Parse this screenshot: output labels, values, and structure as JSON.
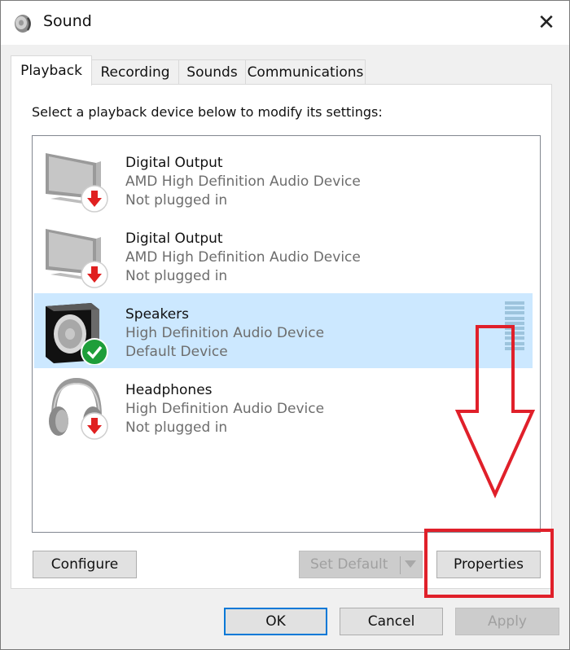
{
  "window": {
    "title": "Sound",
    "icon": "speaker-icon",
    "close_icon": "close-icon",
    "close_glyph": "✕"
  },
  "tabs": [
    {
      "label": "Playback",
      "active": true
    },
    {
      "label": "Recording",
      "active": false
    },
    {
      "label": "Sounds",
      "active": false
    },
    {
      "label": "Communications",
      "active": false
    }
  ],
  "playback": {
    "instruction": "Select a playback device below to modify its settings:",
    "devices": [
      {
        "name": "Digital Output",
        "description": "AMD High Definition Audio Device",
        "status": "Not plugged in",
        "icon": "monitor-icon",
        "badge": "unplugged-badge-icon",
        "selected": false
      },
      {
        "name": "Digital Output",
        "description": "AMD High Definition Audio Device",
        "status": "Not plugged in",
        "icon": "monitor-icon",
        "badge": "unplugged-badge-icon",
        "selected": false
      },
      {
        "name": "Speakers",
        "description": "High Definition Audio Device",
        "status": "Default Device",
        "icon": "speaker-box-icon",
        "badge": "default-check-badge-icon",
        "selected": true
      },
      {
        "name": "Headphones",
        "description": "High Definition Audio Device",
        "status": "Not plugged in",
        "icon": "headphones-icon",
        "badge": "unplugged-badge-icon",
        "selected": false
      }
    ],
    "buttons": {
      "configure": "Configure",
      "set_default": "Set Default",
      "properties": "Properties"
    }
  },
  "dialog_buttons": {
    "ok": "OK",
    "cancel": "Cancel",
    "apply": "Apply"
  },
  "colors": {
    "selection": "#cce8ff",
    "annotation": "#e0202a",
    "default_button_border": "#0078d7",
    "unplugged_badge": "#e02020",
    "default_badge": "#1e9e3a"
  },
  "annotations": {
    "arrow_target": "properties-button",
    "highlight_target": "properties-button"
  }
}
